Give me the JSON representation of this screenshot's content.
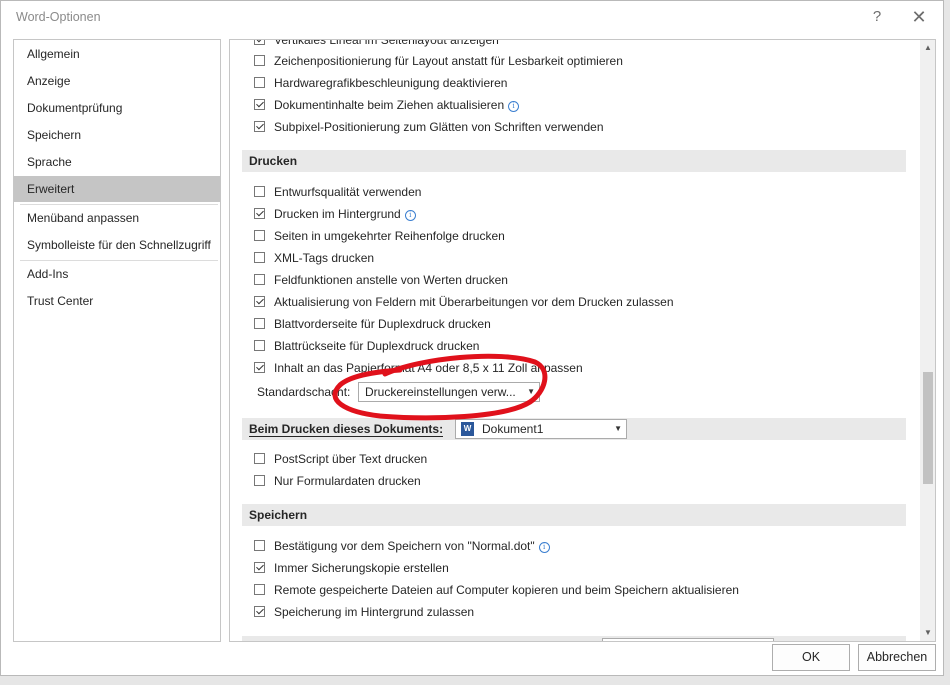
{
  "window": {
    "title": "Word-Optionen",
    "help_glyph": "?",
    "close_glyph": "✕"
  },
  "nav": {
    "items": [
      {
        "label": "Allgemein",
        "selected": false
      },
      {
        "label": "Anzeige",
        "selected": false
      },
      {
        "label": "Dokumentprüfung",
        "selected": false
      },
      {
        "label": "Speichern",
        "selected": false
      },
      {
        "label": "Sprache",
        "selected": false
      },
      {
        "label": "Erweitert",
        "selected": true
      },
      {
        "label": "Menüband anpassen",
        "selected": false
      },
      {
        "label": "Symbolleiste für den Schnellzugriff",
        "selected": false
      },
      {
        "label": "Add-Ins",
        "selected": false
      },
      {
        "label": "Trust Center",
        "selected": false
      }
    ]
  },
  "display": {
    "items": [
      {
        "label": "Vertikales Lineal im Seitenlayout anzeigen",
        "checked": true
      },
      {
        "label": "Zeichenpositionierung für Layout anstatt für Lesbarkeit optimieren",
        "checked": false
      },
      {
        "label": "Hardwaregrafikbeschleunigung deaktivieren",
        "checked": false
      },
      {
        "label": "Dokumentinhalte beim Ziehen aktualisieren",
        "checked": true
      },
      {
        "label": "Subpixel-Positionierung zum Glätten von Schriften verwenden",
        "checked": true
      }
    ]
  },
  "print": {
    "header": "Drucken",
    "items": [
      {
        "label": "Entwurfsqualität verwenden",
        "checked": false
      },
      {
        "label": "Drucken im Hintergrund",
        "checked": true
      },
      {
        "label": "Seiten in umgekehrter Reihenfolge drucken",
        "checked": false
      },
      {
        "label": "XML-Tags drucken",
        "checked": false
      },
      {
        "label": "Feldfunktionen anstelle von Werten drucken",
        "checked": false
      },
      {
        "label": "Aktualisierung von Feldern mit Überarbeitungen vor dem Drucken zulassen",
        "checked": true
      },
      {
        "label": "Blattvorderseite für Duplexdruck drucken",
        "checked": false
      },
      {
        "label": "Blattrückseite für Duplexdruck drucken",
        "checked": false
      },
      {
        "label": "Inhalt an das Papierformat A4 oder 8,5 x 11 Zoll anpassen",
        "checked": true
      }
    ],
    "tray_label": "Standardschacht:",
    "tray_value": "Druckereinstellungen verw..."
  },
  "print_doc": {
    "header": "Beim Drucken dieses Dokuments:",
    "doc_value": "Dokument1",
    "items": [
      {
        "label": "PostScript über Text drucken",
        "checked": false
      },
      {
        "label": "Nur Formulardaten drucken",
        "checked": false
      }
    ]
  },
  "save": {
    "header": "Speichern",
    "items": [
      {
        "label": "Bestätigung vor dem Speichern von \"Normal.dot\"",
        "checked": false
      },
      {
        "label": "Immer Sicherungskopie erstellen",
        "checked": true
      },
      {
        "label": "Remote gespeicherte Dateien auf Computer kopieren und beim Speichern aktualisieren",
        "checked": false
      },
      {
        "label": "Speicherung im Hintergrund zulassen",
        "checked": true
      }
    ]
  },
  "footer": {
    "ok_label": "OK",
    "cancel_label": "Abbrechen"
  },
  "colors": {
    "annotation_ink": "#e0111b",
    "selected_nav": "#c5c5c5",
    "section_bg": "#e9e9e9",
    "info_icon": "#3b7fd0"
  }
}
